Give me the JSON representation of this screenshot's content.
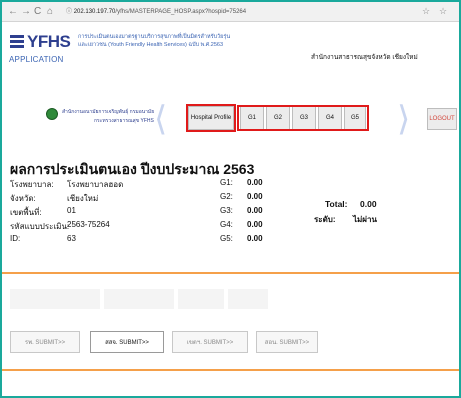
{
  "browser": {
    "back": "←",
    "forward": "→",
    "reload": "C",
    "home": "⌂",
    "info": "ⓘ",
    "url_host": "202.130.197.70",
    "url_path": "/yfhs/MASTERPAGE_HOSP.aspx?hospid=75264",
    "bookmark": "☆",
    "menu": "☆"
  },
  "header": {
    "logo_text": "YFHS",
    "logo_sub": "APPLICATION",
    "program_line1": "การประเมินตนเองมาตรฐานบริการสุขภาพที่เป็นมิตรสำหรับวัยรุ่น",
    "program_line2": "และเยาวชน (Youth Friendly Health Services) ฉบับ พ.ศ.2563",
    "office": "สำนักงานสาธารณสุขจังหวัด เชียงใหม่"
  },
  "nav": {
    "ministry_line1": "สำนักงานอนามัยการเจริญพันธุ์ กรมอนามัย",
    "ministry_line2": "กระทรวงสาธารณสุข YFHS",
    "hospital_profile": "Hospital Profile",
    "g_tabs": [
      "G1",
      "G2",
      "G3",
      "G4",
      "G5"
    ],
    "logout": "LOGOUT"
  },
  "results": {
    "title": "ผลการประเมินตนเอง ปีงบประมาณ 2563",
    "fields": [
      {
        "label": "โรงพยาบาล:",
        "value": "โรงพยาบาลฮอด"
      },
      {
        "label": "จังหวัด:",
        "value": "เชียงใหม่"
      },
      {
        "label": "เขตพื้นที่:",
        "value": "01"
      },
      {
        "label": "รหัสแบบประเมิน:",
        "value": "2563-75264"
      },
      {
        "label": "ID:",
        "value": "63"
      }
    ],
    "g_scores": [
      {
        "label": "G1:",
        "value": "0.00"
      },
      {
        "label": "G2:",
        "value": "0.00"
      },
      {
        "label": "G3:",
        "value": "0.00"
      },
      {
        "label": "G4:",
        "value": "0.00"
      },
      {
        "label": "G5:",
        "value": "0.00"
      }
    ],
    "total_label": "Total:",
    "total_value": "0.00",
    "level_label": "ระดับ:",
    "level_value": "ไม่ผ่าน"
  },
  "submit_buttons": [
    {
      "label": "รพ. SUBMIT>>",
      "active": false
    },
    {
      "label": "สสจ. SUBMIT>>",
      "active": true
    },
    {
      "label": "เขตฯ. SUBMIT>>",
      "active": false
    },
    {
      "label": "สอน. SUBMIT>>",
      "active": false
    }
  ],
  "colors": {
    "frame": "#1aa99c",
    "brand": "#2e3f8f",
    "highlight": "#e01a1a",
    "orange_rule": "#f5a04a",
    "logout_text": "#d2463b"
  }
}
